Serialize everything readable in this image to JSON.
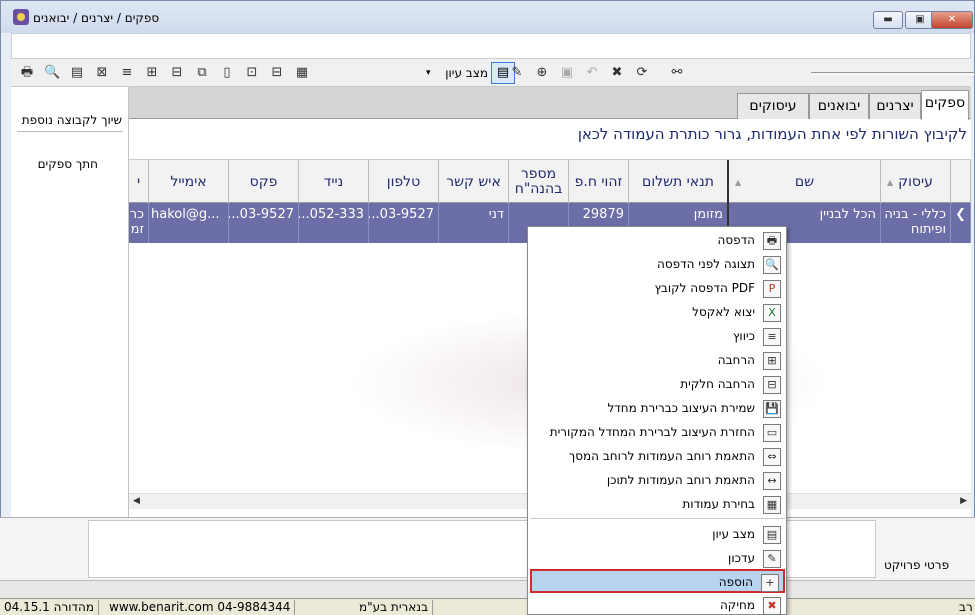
{
  "window": {
    "title": "ספקים / יצרנים / יבואנים",
    "buttons": {
      "minimize": "▬",
      "restore": "▣",
      "close": "✕"
    }
  },
  "toolbar": {
    "view_mode_label": "מצב עיון",
    "view_mode_arrow": "▾",
    "icons": [
      "print-icon",
      "print-preview-icon",
      "pdf-icon",
      "excel-icon",
      "collapse-icon",
      "expand-icon",
      "partial-expand-icon",
      "save-layout-icon",
      "restore-layout-icon",
      "fit-screen-icon",
      "fit-content-icon",
      "select-columns-icon",
      "edit-icon",
      "add-icon",
      "save-icon",
      "undo-icon",
      "delete-icon",
      "refresh-icon",
      "binoculars-icon"
    ]
  },
  "sidebar": {
    "items": [
      {
        "label": "שיוך לקבוצה נוספת"
      },
      {
        "label": "חתך ספקים"
      }
    ]
  },
  "tabs": [
    {
      "label": "ספקים",
      "active": true
    },
    {
      "label": "יצרנים",
      "active": false
    },
    {
      "label": "יבואנים",
      "active": false
    },
    {
      "label": "עיסוקים",
      "active": false
    }
  ],
  "group_hint": "לקיבוץ השורות לפי אחת העמודות, גרור כותרת העמודה לכאן",
  "table": {
    "columns": [
      "עיסוק",
      "שם",
      "תנאי תשלום",
      "זהוי ח.פ",
      "מספר בהנה\"ח",
      "איש קשר",
      "טלפון",
      "נייד",
      "פקס",
      "אימייל",
      "י"
    ],
    "row": {
      "profession": "כללי - בניה ופיתוח",
      "name": "הכל לבניין",
      "payment_terms": "מזומן",
      "company_id": "29879",
      "accounting_no": "",
      "contact": "דני",
      "phone": "03-9527...",
      "mobile": "052-333...",
      "fax": "03-9527...",
      "email": "hakol@g...",
      "extra": "כר זמ"
    }
  },
  "lower": {
    "project_details": "פרטי פרויקט"
  },
  "status": {
    "segments": [
      "04.15.1 מהדורה",
      "www.benarit.com   04-9884344",
      "בנארית בע\"מ",
      "רב"
    ]
  },
  "context_menu": {
    "items": [
      {
        "label": "הדפסה",
        "icon": "🖶"
      },
      {
        "label": "תצוגה לפני הדפסה",
        "icon": "🔍"
      },
      {
        "label": "PDF הדפסה לקובץ",
        "icon": "P"
      },
      {
        "label": "יצוא לאקסל",
        "icon": "X"
      },
      {
        "label": "כיווץ",
        "icon": "≡"
      },
      {
        "label": "הרחבה",
        "icon": "⊞"
      },
      {
        "label": "הרחבה חלקית",
        "icon": "⊟"
      },
      {
        "label": "שמירת  העיצוב כברירת מחדל",
        "icon": "💾"
      },
      {
        "label": "החזרת  העיצוב לברירת המחדל המקורית",
        "icon": "▭"
      },
      {
        "label": "התאמת רוחב העמודות לרוחב המסך",
        "icon": "⇔"
      },
      {
        "label": "התאמת רוחב העמודות לתוכן",
        "icon": "↔"
      },
      {
        "label": "בחירת עמודות",
        "icon": "▦"
      },
      {
        "label": "מצב עיון",
        "icon": "▤"
      },
      {
        "label": "עדכון",
        "icon": "✎"
      },
      {
        "label": "הוספה",
        "icon": "+"
      },
      {
        "label": "מחיקה",
        "icon": "✖"
      }
    ]
  }
}
